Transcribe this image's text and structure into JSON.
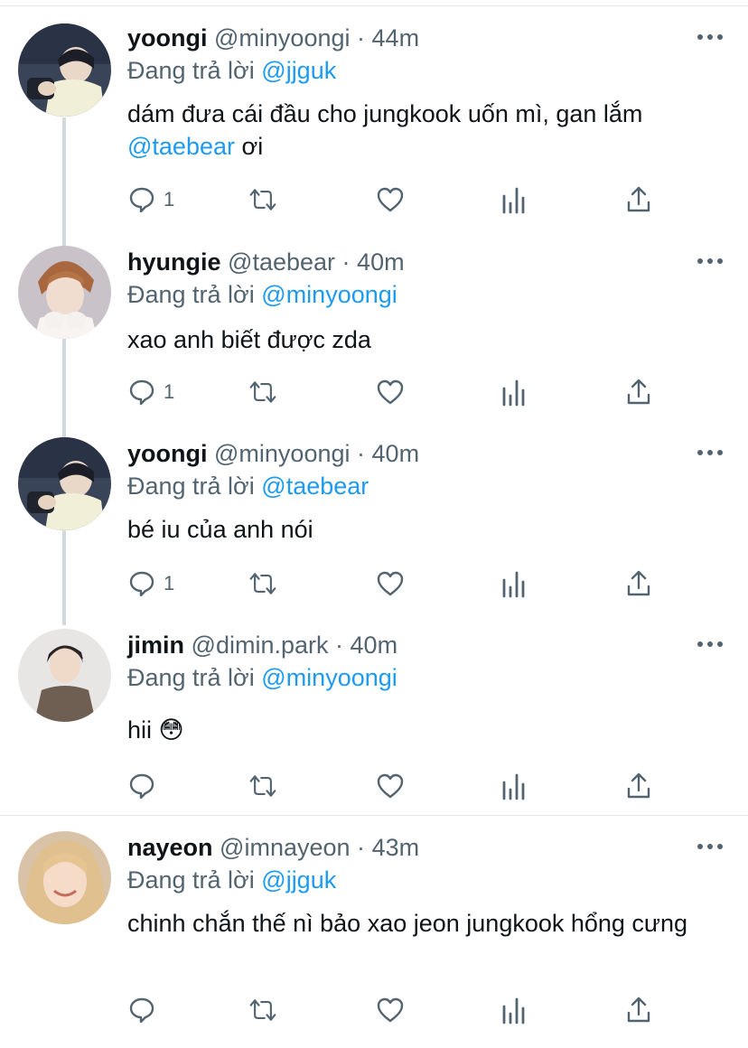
{
  "replying_label": "Đang trả lời",
  "tweets": [
    {
      "name": "yoongi",
      "handle": "@minyoongi",
      "sep": "·",
      "time": "44m",
      "replying_to": "@jjguk",
      "text_parts": [
        "dám đưa cái đầu cho jungkook uốn mì, gan lắm ",
        "@taebear",
        " ơi"
      ],
      "reply_count": "1"
    },
    {
      "name": "hyungie",
      "handle": "@taebear",
      "sep": "·",
      "time": "40m",
      "replying_to": "@minyoongi",
      "text": "xao anh biết được zda",
      "reply_count": "1"
    },
    {
      "name": "yoongi",
      "handle": "@minyoongi",
      "sep": "·",
      "time": "40m",
      "replying_to": "@taebear",
      "text": "bé iu của anh nói",
      "reply_count": "1"
    },
    {
      "name": "jimin",
      "handle": "@dimin.park",
      "sep": "·",
      "time": "40m",
      "replying_to": "@minyoongi",
      "text": "hii 😳",
      "reply_count": ""
    },
    {
      "name": "nayeon",
      "handle": "@imnayeon",
      "sep": "·",
      "time": "43m",
      "replying_to": "@jjguk",
      "text": "chinh chắn thế nì bảo xao jeon jungkook hổng cưng",
      "reply_count": ""
    }
  ],
  "icons": {
    "reply": "reply-icon",
    "retweet": "retweet-icon",
    "like": "heart-icon",
    "analytics": "analytics-icon",
    "share": "share-icon",
    "more": "more-icon"
  },
  "colors": {
    "link": "#1d9bf0",
    "secondary_text": "#536471",
    "thread_line": "#cfd9de"
  }
}
